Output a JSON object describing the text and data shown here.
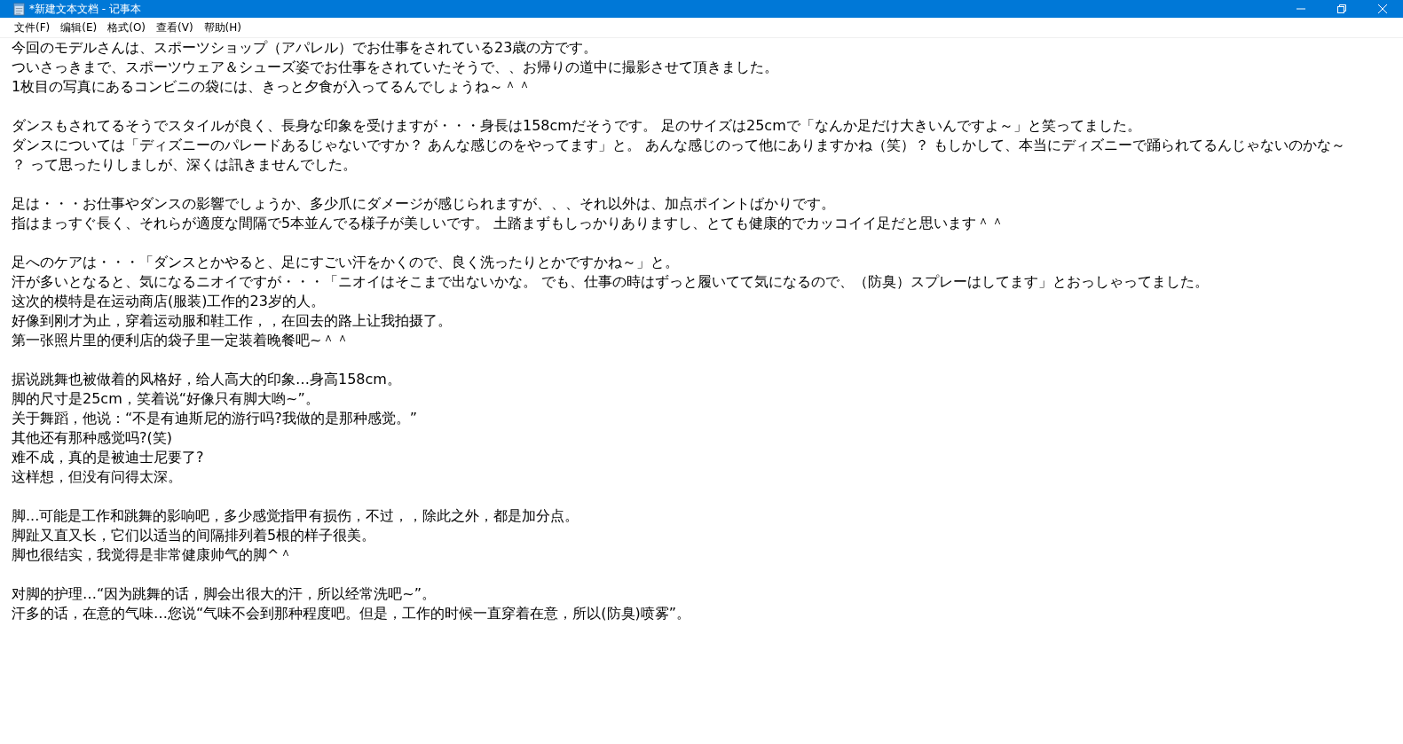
{
  "window": {
    "title": "*新建文本文档 - 记事本"
  },
  "menu": [
    "文件(F)",
    "编辑(E)",
    "格式(O)",
    "查看(V)",
    "帮助(H)"
  ],
  "paragraphs": [
    [
      "今回のモデルさんは、スポーツショップ（アパレル）でお仕事をされている23歳の方です。",
      "ついさっきまで、スポーツウェア＆シューズ姿でお仕事をされていたそうで、、お帰りの道中に撮影させて頂きました。",
      "1枚目の写真にあるコンビニの袋には、きっと夕食が入ってるんでしょうね～＾＾"
    ],
    [
      "ダンスもされてるそうでスタイルが良く、長身な印象を受けますが・・・身長は158cmだそうです。 足のサイズは25cmで「なんか足だけ大きいんですよ～」と笑ってました。",
      "ダンスについては「ディズニーのパレードあるじゃないですか？ あんな感じのをやってます」と。 あんな感じのって他にありますかね（笑）？ もしかして、本当にディズニーで踊られてるんじゃないのかな～",
      "？ って思ったりしましが、深くは訊きませんでした。"
    ],
    [
      "足は・・・お仕事やダンスの影響でしょうか、多少爪にダメージが感じられますが、、、それ以外は、加点ポイントばかりです。",
      "指はまっすぐ長く、それらが適度な間隔で5本並んでる様子が美しいです。 土踏まずもしっかりありますし、とても健康的でカッコイイ足だと思います＾＾"
    ],
    [
      "足へのケアは・・・「ダンスとかやると、足にすごい汗をかくので、良く洗ったりとかですかね～」と。",
      "汗が多いとなると、気になるニオイですが・・・「ニオイはそこまで出ないかな。 でも、仕事の時はずっと履いてて気になるので、（防臭）スプレーはしてます」とおっしゃってました。",
      "这次的模特是在运动商店(服装)工作的23岁的人。",
      "好像到刚才为止，穿着运动服和鞋工作，，在回去的路上让我拍摄了。",
      "第一张照片里的便利店的袋子里一定装着晚餐吧~＾＾"
    ],
    [
      "据说跳舞也被做着的风格好，给人高大的印象…身高158cm。",
      "脚的尺寸是25cm，笑着说“好像只有脚大哟~”。",
      "关于舞蹈，他说：“不是有迪斯尼的游行吗?我做的是那种感觉。”",
      "其他还有那种感觉吗?(笑)",
      "难不成，真的是被迪士尼要了?",
      "这样想，但没有问得太深。"
    ],
    [
      "脚...可能是工作和跳舞的影响吧，多少感觉指甲有损伤，不过，，除此之外，都是加分点。",
      "脚趾又直又长，它们以适当的间隔排列着5根的样子很美。",
      "脚也很结实，我觉得是非常健康帅气的脚^＾"
    ],
    [
      "对脚的护理…“因为跳舞的话，脚会出很大的汗，所以经常洗吧~”。",
      "汗多的话，在意的气味…您说“气味不会到那种程度吧。但是，工作的时候一直穿着在意，所以(防臭)喷雾”。"
    ]
  ]
}
